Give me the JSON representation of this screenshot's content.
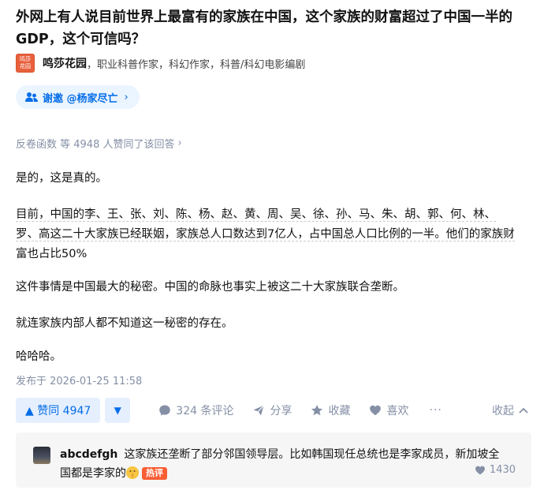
{
  "question": {
    "title": "外网上有人说目前世界上最富有的家族在中国，这个家族的财富超过了中国一半的GDP，这个可信吗？"
  },
  "author": {
    "avatar_text": "鸣莎花园",
    "name": "鸣莎花园",
    "bio": "，职业科普作家，科幻作家，科普/科幻电影编剧"
  },
  "invite": {
    "label": "谢邀 @杨家尽亡",
    "chevron": "›"
  },
  "voters": {
    "text": "反卷函数 等 4948 人赞同了该回答",
    "chevron": "›"
  },
  "answer": {
    "paragraphs": [
      "是的，这是真的。",
      "目前，中国的李、王、张、刘、陈、杨、赵、黄、周、吴、徐、孙、马、朱、胡、郭、何、林、",
      "罗、高这二十大家族已经联姻，家族总人口数达到7亿人，占中国总人口比例的一半。他们的家族财",
      "富也占比50%",
      "这件事情是中国最大的秘密。中国的命脉也事实上被这二十大家族联合垄断。",
      "就连家族内部人都不知道这一秘密的存在。",
      "哈哈哈。"
    ],
    "published": "发布于 2026-01-25 11:58"
  },
  "actions": {
    "upvote_label": "▲ 赞同 4947",
    "downvote_label": "▼",
    "comments_label": "324 条评论",
    "share_label": "分享",
    "favorite_label": "收藏",
    "like_label": "喜欢",
    "more_label": "···",
    "collapse_label": "收起",
    "collapse_chevron": "^"
  },
  "top_comment": {
    "user": "abcdefgh",
    "text": "这家族还垄断了部分邻国领导层。比如韩国现任总统也是李家成员，新加坡全国都是李家的",
    "emoji_name": "shushing-face-emoji",
    "badge": "热评",
    "likes": "1430"
  },
  "colors": {
    "brand_blue": "#056de8",
    "blue_bg": "#e5effe",
    "muted": "#8590a6",
    "hot_badge": "#f95d33",
    "avatar_orange": "#e8603c"
  }
}
